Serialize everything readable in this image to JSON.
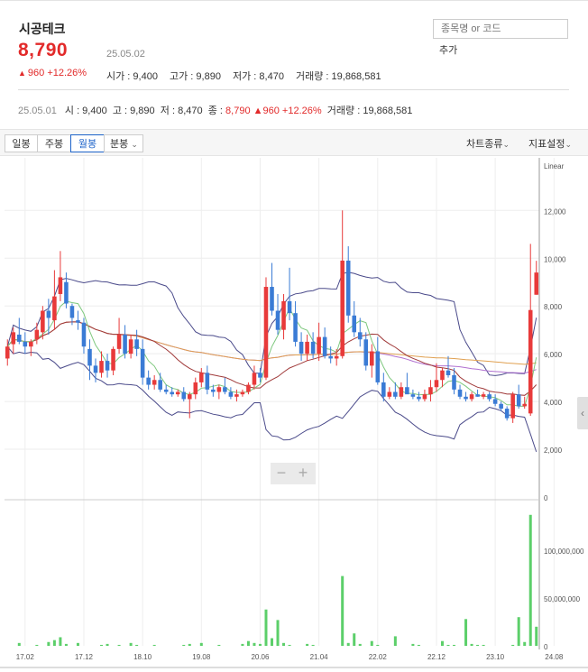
{
  "stock": {
    "name": "시공테크",
    "price": "8,790",
    "date": "25.05.02",
    "change": "960 +12.26%",
    "up_symbol": "▲",
    "open": "시가 : 9,400",
    "high": "고가 : 9,890",
    "low": "저가 : 8,470",
    "volume": "거래량 : 19,868,581"
  },
  "search": {
    "placeholder": "종목명 or 코드",
    "add_label": "추가"
  },
  "summary": {
    "date": "25.05.01",
    "open": "시 : 9,400",
    "high": "고 : 9,890",
    "low": "저 : 8,470",
    "close_label": "종 :",
    "close_value": "8,790",
    "change": "▲960 +12.26%",
    "volume": "거래량 : 19,868,581"
  },
  "toolbar": {
    "tabs": [
      "일봉",
      "주봉",
      "월봉",
      "분봉"
    ],
    "active_tab": "월봉",
    "chart_type": "차트종류",
    "indicator": "지표설정"
  },
  "colors": {
    "up": "#e83a3a",
    "down": "#3a7bd5",
    "volume": "#5ccf6a",
    "bollinger": "#4a4a8a",
    "ma5": "#7ec87e",
    "ma20": "#a03a3a",
    "ma60": "#b070d0",
    "ma120": "#e0a050"
  },
  "icons": {
    "side_handle": "chevron-left-icon",
    "zoom_out": "minus-icon",
    "zoom_in": "plus-icon"
  },
  "chart_data": {
    "type": "candlestick",
    "scale_label": "Linear",
    "price_ticks": [
      "12,000",
      "10,000",
      "8,000",
      "6,000",
      "4,000",
      "2,000",
      "0"
    ],
    "ylim": [
      0,
      13900
    ],
    "volume_ticks": [
      "100,000,000",
      "50,000,000",
      "0"
    ],
    "volume_ylim": [
      0,
      150000000
    ],
    "x_ticks": [
      "17.02",
      "17.12",
      "18.10",
      "19.08",
      "20.06",
      "21.04",
      "22.02",
      "22.12",
      "23.10",
      "24.08"
    ],
    "start": "2016-11",
    "ohlc": [
      [
        5800,
        6600,
        5500,
        6300
      ],
      [
        6400,
        7100,
        6000,
        6900
      ],
      [
        6800,
        7500,
        6400,
        6500
      ],
      [
        6500,
        6900,
        6000,
        6300
      ],
      [
        6300,
        6600,
        5900,
        6500
      ],
      [
        6600,
        7300,
        6400,
        7000
      ],
      [
        6900,
        8000,
        6600,
        7800
      ],
      [
        7800,
        8300,
        6800,
        7500
      ],
      [
        7400,
        9500,
        7000,
        8400
      ],
      [
        8500,
        10300,
        8200,
        9200
      ],
      [
        9000,
        9400,
        7900,
        8100
      ],
      [
        8000,
        8100,
        7200,
        7500
      ],
      [
        7400,
        7800,
        7000,
        7300
      ],
      [
        7300,
        7500,
        6000,
        6300
      ],
      [
        6200,
        6600,
        4900,
        5500
      ],
      [
        5500,
        5800,
        4800,
        5200
      ],
      [
        5200,
        6100,
        5000,
        5700
      ],
      [
        5700,
        6000,
        5000,
        5300
      ],
      [
        5300,
        6300,
        5100,
        6200
      ],
      [
        6200,
        7500,
        6000,
        6800
      ],
      [
        6800,
        7200,
        5800,
        6000
      ],
      [
        6000,
        6800,
        5800,
        6600
      ],
      [
        6600,
        7000,
        5900,
        6200
      ],
      [
        6200,
        6600,
        4700,
        5000
      ],
      [
        5000,
        5300,
        4500,
        4700
      ],
      [
        4700,
        5100,
        4500,
        4900
      ],
      [
        4900,
        5200,
        4400,
        4500
      ],
      [
        4500,
        4700,
        4300,
        4400
      ],
      [
        4400,
        4600,
        4200,
        4300
      ],
      [
        4300,
        4500,
        4200,
        4400
      ],
      [
        4400,
        4600,
        4000,
        4100
      ],
      [
        4100,
        4400,
        3300,
        4300
      ],
      [
        4300,
        5000,
        4100,
        4800
      ],
      [
        4800,
        5400,
        4600,
        5200
      ],
      [
        5200,
        5500,
        4300,
        4500
      ],
      [
        4500,
        4700,
        4200,
        4400
      ],
      [
        4400,
        4700,
        4100,
        4600
      ],
      [
        4600,
        5000,
        4300,
        4400
      ],
      [
        4400,
        4600,
        4100,
        4200
      ],
      [
        4200,
        4500,
        4000,
        4300
      ],
      [
        4300,
        4500,
        4200,
        4400
      ],
      [
        4400,
        4800,
        4300,
        4700
      ],
      [
        4700,
        5500,
        4500,
        5200
      ],
      [
        5200,
        5400,
        4800,
        5000
      ],
      [
        5000,
        9200,
        4900,
        8800
      ],
      [
        8800,
        9800,
        7600,
        7800
      ],
      [
        7800,
        8500,
        6800,
        7000
      ],
      [
        7000,
        8500,
        6600,
        8200
      ],
      [
        8200,
        9600,
        7400,
        7700
      ],
      [
        7700,
        8200,
        6300,
        6500
      ],
      [
        6500,
        6900,
        5700,
        6000
      ],
      [
        6000,
        6800,
        5700,
        6500
      ],
      [
        6500,
        6900,
        5800,
        6000
      ],
      [
        6000,
        7300,
        5700,
        6700
      ],
      [
        6700,
        7100,
        5800,
        5900
      ],
      [
        5900,
        6300,
        5600,
        5800
      ],
      [
        5800,
        6200,
        5500,
        5900
      ],
      [
        5900,
        12000,
        5800,
        9900
      ],
      [
        9900,
        10500,
        7300,
        7600
      ],
      [
        7600,
        8200,
        6700,
        6900
      ],
      [
        6900,
        7500,
        6300,
        6600
      ],
      [
        6600,
        6900,
        5300,
        5500
      ],
      [
        5500,
        6400,
        5000,
        6100
      ],
      [
        6100,
        6700,
        4700,
        4800
      ],
      [
        4800,
        5200,
        4000,
        4200
      ],
      [
        4200,
        4600,
        4100,
        4400
      ],
      [
        4400,
        4800,
        4100,
        4200
      ],
      [
        4200,
        4800,
        4100,
        4600
      ],
      [
        4600,
        5200,
        4400,
        4300
      ],
      [
        4300,
        4500,
        4100,
        4200
      ],
      [
        4200,
        4400,
        4000,
        4100
      ],
      [
        4100,
        4500,
        4000,
        4300
      ],
      [
        4300,
        4900,
        4000,
        4600
      ],
      [
        4600,
        5600,
        4400,
        4900
      ],
      [
        4900,
        5400,
        4600,
        5300
      ],
      [
        5300,
        5900,
        5000,
        5100
      ],
      [
        5100,
        5400,
        4300,
        4500
      ],
      [
        4500,
        4700,
        4100,
        4200
      ],
      [
        4200,
        4400,
        4000,
        4100
      ],
      [
        4100,
        4400,
        4000,
        4300
      ],
      [
        4300,
        4500,
        4200,
        4200
      ],
      [
        4200,
        4400,
        4100,
        4300
      ],
      [
        4300,
        4400,
        4000,
        4100
      ],
      [
        4100,
        4300,
        3800,
        3900
      ],
      [
        3900,
        4000,
        3600,
        3700
      ],
      [
        3700,
        3800,
        3200,
        3300
      ],
      [
        3300,
        4400,
        3100,
        4300
      ],
      [
        4300,
        4700,
        3700,
        3800
      ],
      [
        3800,
        4200,
        3700,
        3900
      ],
      [
        3500,
        10600,
        3400,
        7830
      ],
      [
        8470,
        9890,
        8470,
        9400
      ]
    ],
    "volume_millions": [
      0,
      0,
      3,
      0,
      0,
      1,
      0,
      4,
      6,
      9,
      2,
      0,
      3,
      0,
      0,
      0,
      1,
      2,
      0,
      1,
      0,
      3,
      1,
      0,
      0,
      1,
      0,
      0,
      0,
      0,
      1,
      2,
      0,
      3,
      0,
      0,
      1,
      0,
      0,
      0,
      2,
      5,
      3,
      2,
      38,
      8,
      27,
      3,
      1,
      0,
      0,
      2,
      1,
      0,
      0,
      0,
      0,
      73,
      3,
      13,
      2,
      0,
      5,
      1,
      0,
      0,
      10,
      0,
      0,
      2,
      1,
      0,
      0,
      0,
      5,
      1,
      1,
      0,
      28,
      2,
      1,
      1,
      0,
      0,
      0,
      0,
      1,
      30,
      4,
      137,
      20
    ]
  }
}
